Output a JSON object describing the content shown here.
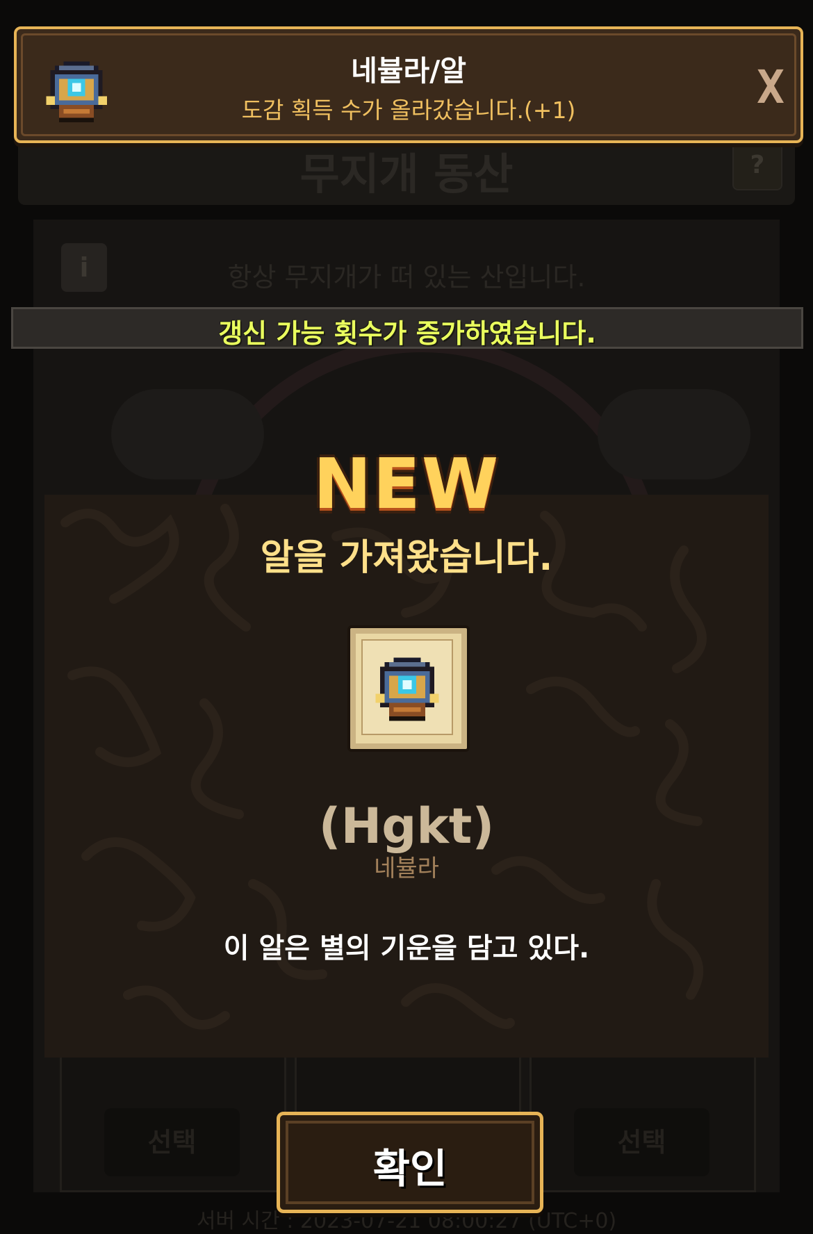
{
  "background": {
    "title": "무지개 동산",
    "help_label": "?",
    "info_label": "i",
    "description": "항상 무지개가 떠 있는 산입니다.",
    "select_labels": [
      "선택",
      "선택"
    ],
    "server_time": "서버 시간 : 2023-07-21 08:00:27 (UTC+0)"
  },
  "banner": {
    "title": "네뷸라/알",
    "subtitle": "도감 획득 수가 올라갔습니다.(+1)",
    "close_label": "X",
    "icon": "nebula-egg-icon"
  },
  "toast": {
    "message": "갱신 가능 횟수가 증가하였습니다."
  },
  "popup": {
    "badge": "NEW",
    "headline": "알을 가져왔습니다.",
    "item_icon": "nebula-egg-icon",
    "item_code": "(Hgkt)",
    "item_name": "네뷸라",
    "item_description": "이 알은 별의 기운을 담고 있다."
  },
  "confirm": {
    "label": "확인"
  },
  "colors": {
    "gold_border": "#e7b456",
    "toast_text": "#eaff5e",
    "headline": "#ffe08a",
    "popup_bg": "#211a14"
  }
}
